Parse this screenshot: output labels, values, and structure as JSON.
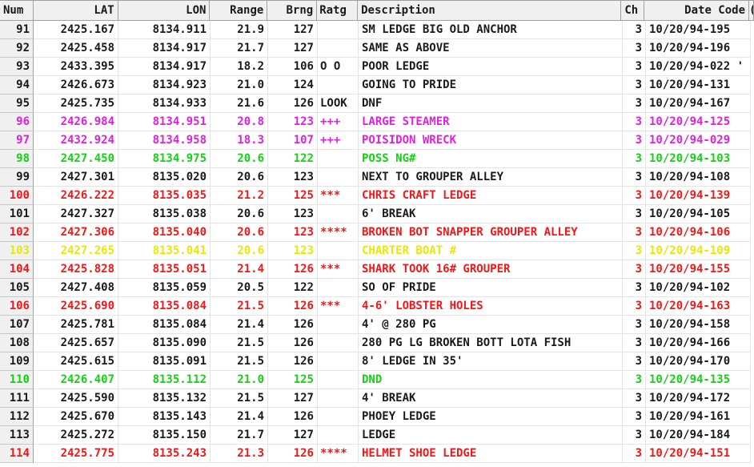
{
  "columns": {
    "num": "Num",
    "lat": "LAT",
    "lon": "LON",
    "range": "Range",
    "brng": "Brng",
    "ratg": "Ratg",
    "description": "Description",
    "ch": "Ch",
    "date_code": "Date Code",
    "extra": "("
  },
  "colors": {
    "black": "#1a1a1a",
    "magenta": "#e020e0",
    "green": "#16d016",
    "red": "#f01818",
    "yellow": "#e8e800"
  },
  "rows": [
    {
      "num": "91",
      "lat": "2425.167",
      "lon": "8134.911",
      "range": "21.9",
      "brng": "127",
      "ratg": "",
      "description": "SM LEDGE BIG OLD ANCHOR",
      "ch": "3",
      "date_code": "10/20/94-195",
      "color": "black"
    },
    {
      "num": "92",
      "lat": "2425.458",
      "lon": "8134.917",
      "range": "21.7",
      "brng": "127",
      "ratg": "",
      "description": "SAME AS ABOVE",
      "ch": "3",
      "date_code": "10/20/94-196",
      "color": "black"
    },
    {
      "num": "93",
      "lat": "2433.395",
      "lon": "8134.917",
      "range": "18.2",
      "brng": "106",
      "ratg": "O O",
      "description": "POOR LEDGE",
      "ch": "3",
      "date_code": "10/20/94-022 '",
      "color": "black"
    },
    {
      "num": "94",
      "lat": "2426.673",
      "lon": "8134.923",
      "range": "21.0",
      "brng": "124",
      "ratg": "",
      "description": "GOING TO PRIDE",
      "ch": "3",
      "date_code": "10/20/94-131",
      "color": "black"
    },
    {
      "num": "95",
      "lat": "2425.735",
      "lon": "8134.933",
      "range": "21.6",
      "brng": "126",
      "ratg": "LOOK",
      "description": "DNF",
      "ch": "3",
      "date_code": "10/20/94-167",
      "color": "black"
    },
    {
      "num": "96",
      "lat": "2426.984",
      "lon": "8134.951",
      "range": "20.8",
      "brng": "123",
      "ratg": "+++",
      "description": "LARGE STEAMER",
      "ch": "3",
      "date_code": "10/20/94-125",
      "color": "magenta"
    },
    {
      "num": "97",
      "lat": "2432.924",
      "lon": "8134.958",
      "range": "18.3",
      "brng": "107",
      "ratg": "+++",
      "description": "POISIDON WRECK",
      "ch": "3",
      "date_code": "10/20/94-029",
      "color": "magenta"
    },
    {
      "num": "98",
      "lat": "2427.450",
      "lon": "8134.975",
      "range": "20.6",
      "brng": "122",
      "ratg": "",
      "description": "POSS NG#",
      "ch": "3",
      "date_code": "10/20/94-103",
      "color": "green"
    },
    {
      "num": "99",
      "lat": "2427.301",
      "lon": "8135.020",
      "range": "20.6",
      "brng": "123",
      "ratg": "",
      "description": "NEXT TO GROUPER ALLEY",
      "ch": "3",
      "date_code": "10/20/94-108",
      "color": "black"
    },
    {
      "num": "100",
      "lat": "2426.222",
      "lon": "8135.035",
      "range": "21.2",
      "brng": "125",
      "ratg": "***",
      "description": "CHRIS CRAFT LEDGE",
      "ch": "3",
      "date_code": "10/20/94-139",
      "color": "red"
    },
    {
      "num": "101",
      "lat": "2427.327",
      "lon": "8135.038",
      "range": "20.6",
      "brng": "123",
      "ratg": "",
      "description": "6' BREAK",
      "ch": "3",
      "date_code": "10/20/94-105",
      "color": "black"
    },
    {
      "num": "102",
      "lat": "2427.306",
      "lon": "8135.040",
      "range": "20.6",
      "brng": "123",
      "ratg": "****",
      "description": "BROKEN BOT SNAPPER GROUPER ALLEY",
      "ch": "3",
      "date_code": "10/20/94-106",
      "color": "red"
    },
    {
      "num": "103",
      "lat": "2427.265",
      "lon": "8135.041",
      "range": "20.6",
      "brng": "123",
      "ratg": "",
      "description": "CHARTER BOAT #",
      "ch": "3",
      "date_code": "10/20/94-109",
      "color": "yellow"
    },
    {
      "num": "104",
      "lat": "2425.828",
      "lon": "8135.051",
      "range": "21.4",
      "brng": "126",
      "ratg": "***",
      "description": "SHARK TOOK 16# GROUPER",
      "ch": "3",
      "date_code": "10/20/94-155",
      "color": "red"
    },
    {
      "num": "105",
      "lat": "2427.408",
      "lon": "8135.059",
      "range": "20.5",
      "brng": "122",
      "ratg": "",
      "description": "SO OF PRIDE",
      "ch": "3",
      "date_code": "10/20/94-102",
      "color": "black"
    },
    {
      "num": "106",
      "lat": "2425.690",
      "lon": "8135.084",
      "range": "21.5",
      "brng": "126",
      "ratg": "***",
      "description": "4-6' LOBSTER HOLES",
      "ch": "3",
      "date_code": "10/20/94-163",
      "color": "red"
    },
    {
      "num": "107",
      "lat": "2425.781",
      "lon": "8135.084",
      "range": "21.4",
      "brng": "126",
      "ratg": "",
      "description": "4' @ 280 PG",
      "ch": "3",
      "date_code": "10/20/94-158",
      "color": "black"
    },
    {
      "num": "108",
      "lat": "2425.657",
      "lon": "8135.090",
      "range": "21.5",
      "brng": "126",
      "ratg": "",
      "description": "280 PG LG BROKEN BOTT LOTA FISH",
      "ch": "3",
      "date_code": "10/20/94-166",
      "color": "black"
    },
    {
      "num": "109",
      "lat": "2425.615",
      "lon": "8135.091",
      "range": "21.5",
      "brng": "126",
      "ratg": "",
      "description": "8' LEDGE IN 35'",
      "ch": "3",
      "date_code": "10/20/94-170",
      "color": "black"
    },
    {
      "num": "110",
      "lat": "2426.407",
      "lon": "8135.112",
      "range": "21.0",
      "brng": "125",
      "ratg": "",
      "description": "DND",
      "ch": "3",
      "date_code": "10/20/94-135",
      "color": "green"
    },
    {
      "num": "111",
      "lat": "2425.590",
      "lon": "8135.132",
      "range": "21.5",
      "brng": "127",
      "ratg": "",
      "description": "4' BREAK",
      "ch": "3",
      "date_code": "10/20/94-172",
      "color": "black"
    },
    {
      "num": "112",
      "lat": "2425.670",
      "lon": "8135.143",
      "range": "21.4",
      "brng": "126",
      "ratg": "",
      "description": "PHOEY LEDGE",
      "ch": "3",
      "date_code": "10/20/94-161",
      "color": "black"
    },
    {
      "num": "113",
      "lat": "2425.272",
      "lon": "8135.150",
      "range": "21.7",
      "brng": "127",
      "ratg": "",
      "description": "LEDGE",
      "ch": "3",
      "date_code": "10/20/94-184",
      "color": "black"
    },
    {
      "num": "114",
      "lat": "2425.775",
      "lon": "8135.243",
      "range": "21.3",
      "brng": "126",
      "ratg": "****",
      "description": "HELMET SHOE LEDGE",
      "ch": "3",
      "date_code": "10/20/94-151",
      "color": "red"
    }
  ]
}
